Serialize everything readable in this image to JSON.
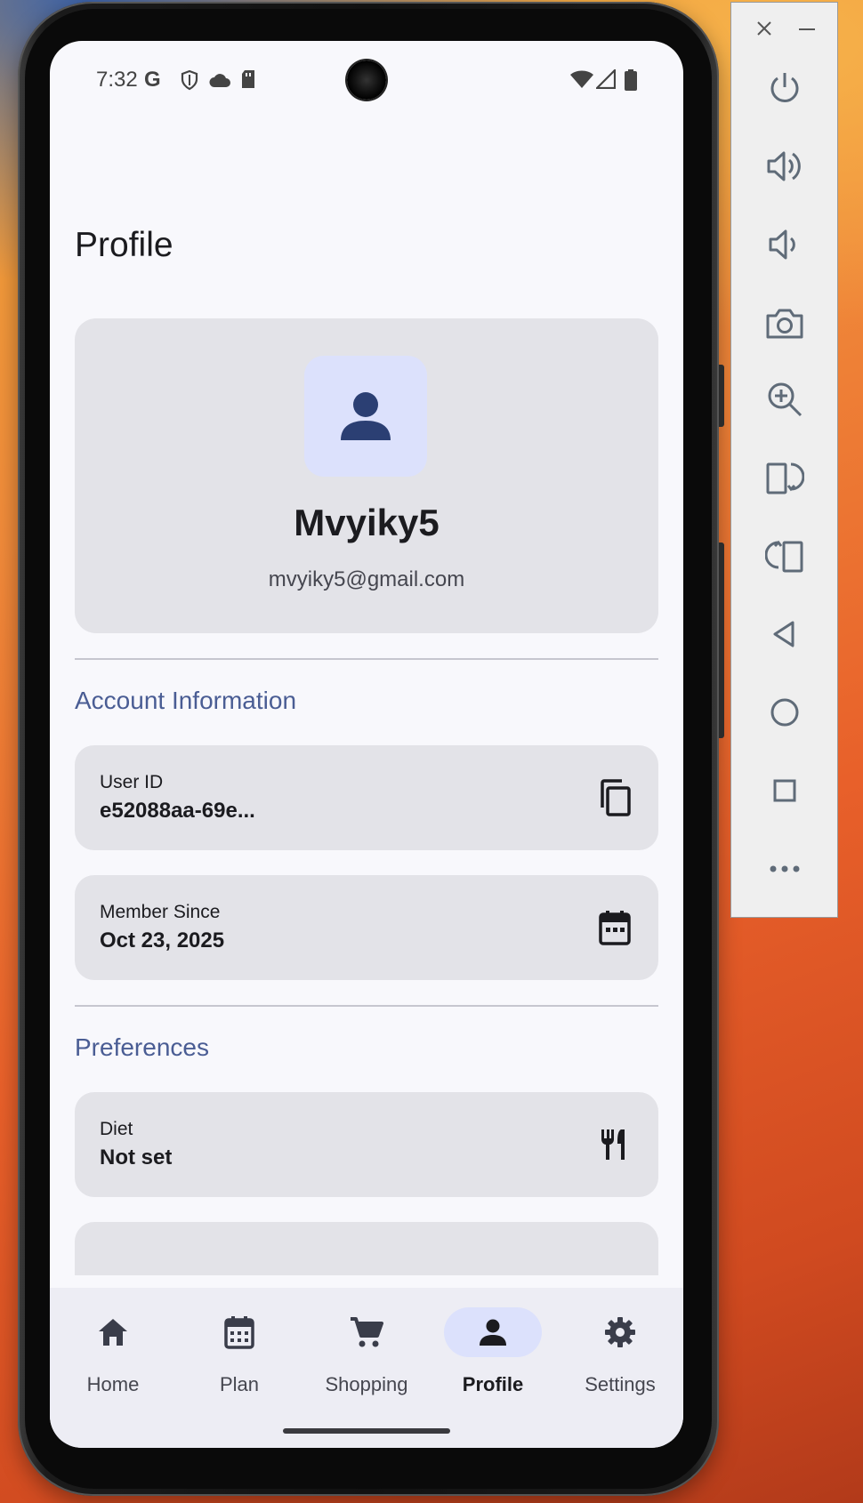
{
  "status_bar": {
    "time": "7:32",
    "left_icons": [
      "google-icon",
      "shield-icon",
      "cloud-icon",
      "sd-card-icon"
    ],
    "right_icons": [
      "wifi-icon",
      "signal-icon",
      "battery-icon"
    ]
  },
  "page": {
    "title": "Profile"
  },
  "profile": {
    "name": "Mvyiky5",
    "email": "mvyiky5@gmail.com",
    "avatar_icon": "person-icon"
  },
  "account_section": {
    "title": "Account Information",
    "items": [
      {
        "label": "User ID",
        "value": "e52088aa-69e...",
        "icon": "copy-icon"
      },
      {
        "label": "Member Since",
        "value": "Oct 23, 2025",
        "icon": "calendar-icon"
      }
    ]
  },
  "preferences_section": {
    "title": "Preferences",
    "items": [
      {
        "label": "Diet",
        "value": "Not set",
        "icon": "restaurant-icon"
      }
    ]
  },
  "bottom_nav": {
    "items": [
      {
        "label": "Home",
        "icon": "home-icon",
        "active": false
      },
      {
        "label": "Plan",
        "icon": "calendar-icon",
        "active": false
      },
      {
        "label": "Shopping",
        "icon": "cart-icon",
        "active": false
      },
      {
        "label": "Profile",
        "icon": "person-icon",
        "active": true
      },
      {
        "label": "Settings",
        "icon": "gear-icon",
        "active": false
      }
    ]
  },
  "emulator_toolbar": {
    "buttons": [
      "close-icon",
      "minimize-icon",
      "power-icon",
      "volume-up-icon",
      "volume-down-icon",
      "camera-icon",
      "zoom-icon",
      "rotate-left-icon",
      "rotate-right-icon",
      "back-icon",
      "home-icon",
      "overview-icon",
      "more-icon"
    ]
  },
  "colors": {
    "accent": "#4a5d94",
    "active_pill": "#dce1fc",
    "card": "#e3e3e8",
    "icon_primary": "#2b3f73"
  }
}
